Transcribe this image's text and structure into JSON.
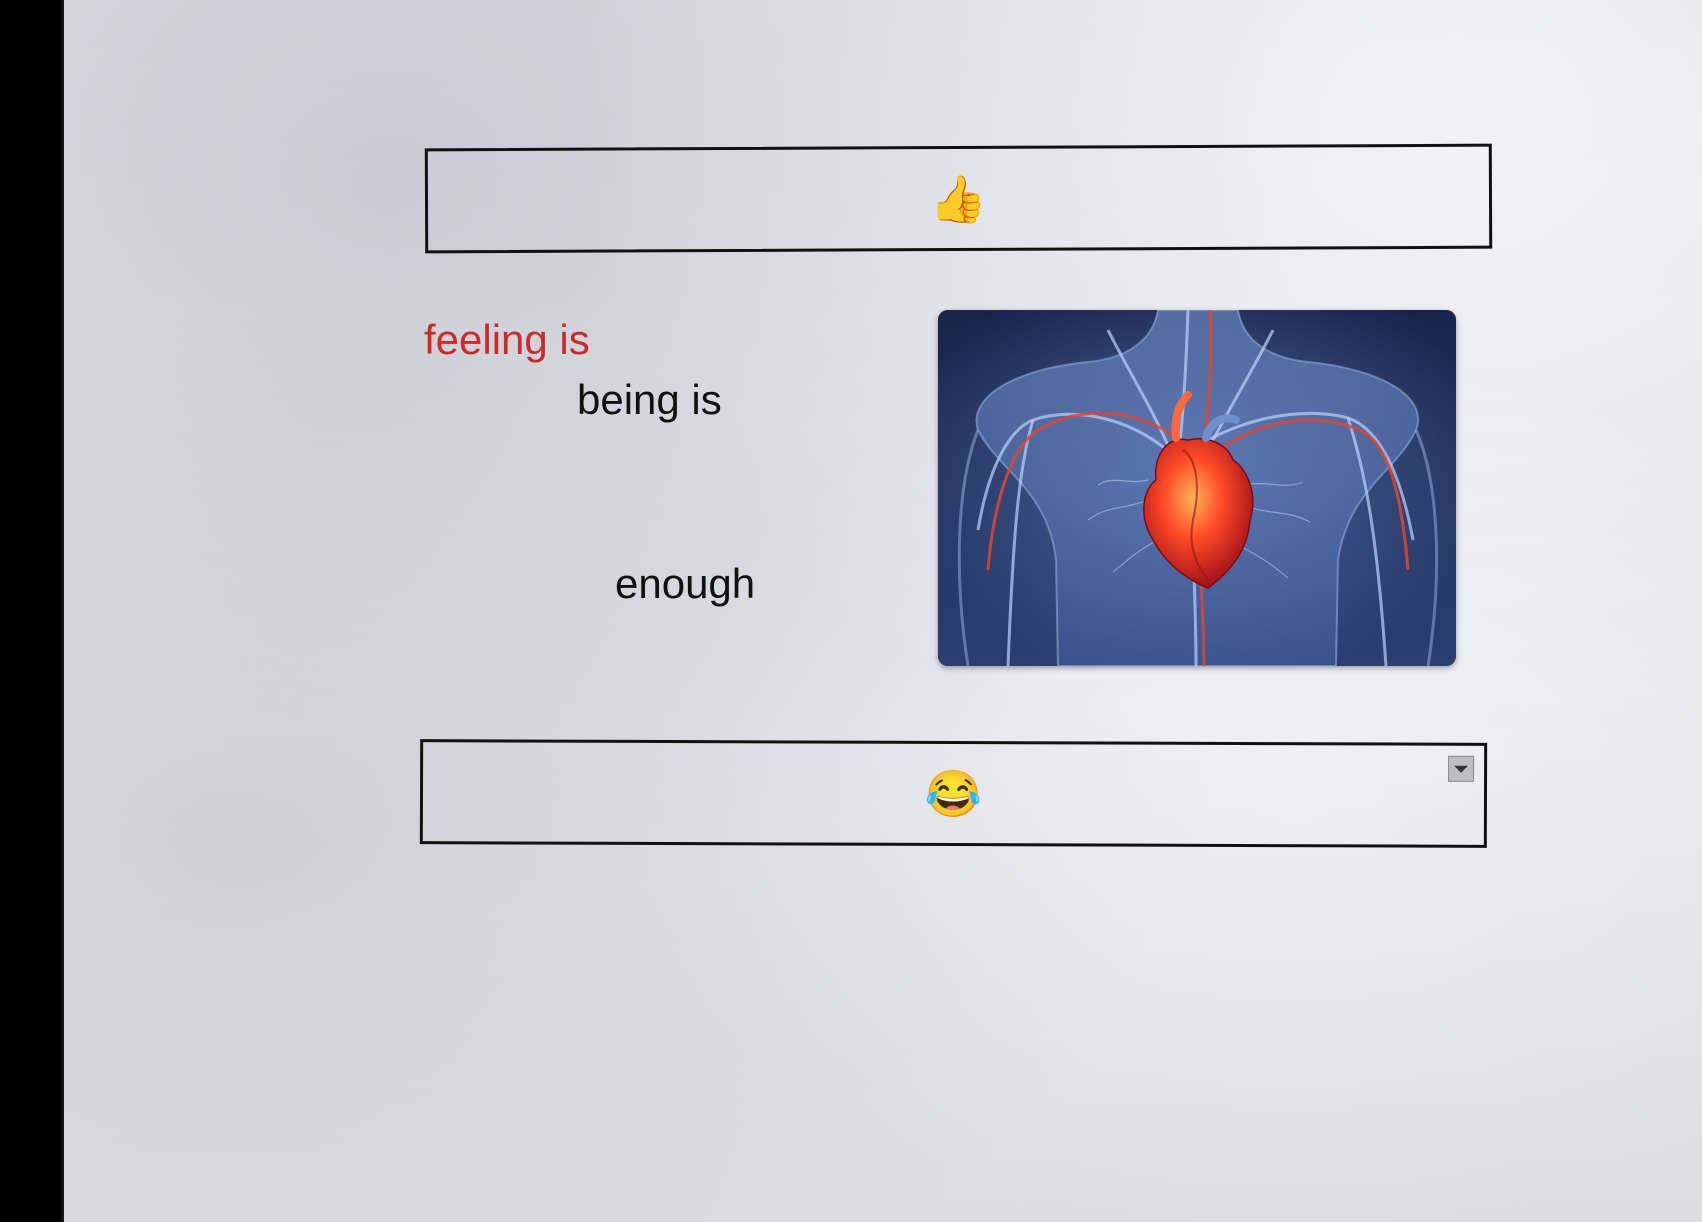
{
  "top_box": {
    "icon": "thumbs-up-icon",
    "emoji": "👍"
  },
  "poem": {
    "line1": "feeling is",
    "line2": "being is",
    "line3": "enough"
  },
  "image": {
    "subject": "heart-circulatory-illustration"
  },
  "bottom_box": {
    "icon": "laughing-tears-icon",
    "emoji": "😂",
    "dropdown_icon": "caret-down-icon"
  },
  "colors": {
    "accent_text": "#cc2a2a",
    "border": "#111111"
  }
}
